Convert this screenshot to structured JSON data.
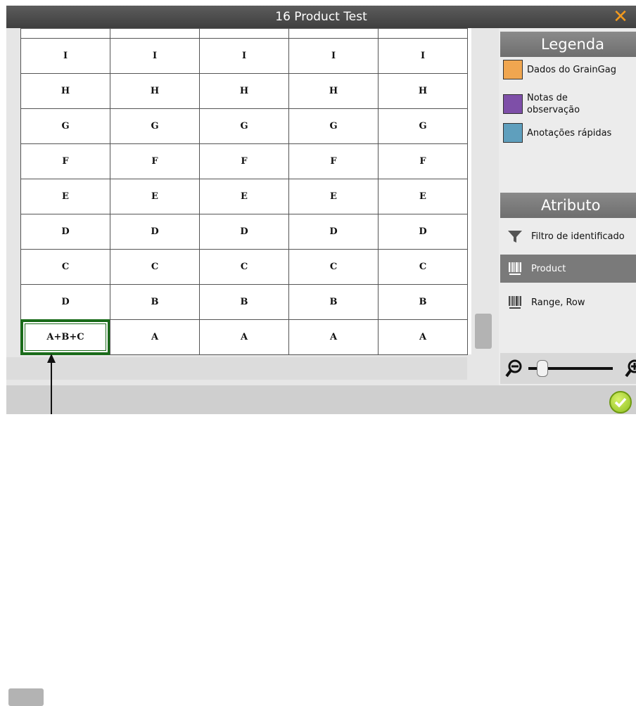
{
  "window": {
    "title": "16 Product Test",
    "close_glyph": "✕"
  },
  "grid": {
    "columns": 5,
    "rows": [
      [
        "",
        "",
        "",
        "",
        ""
      ],
      [
        "I",
        "I",
        "I",
        "I",
        "I"
      ],
      [
        "H",
        "H",
        "H",
        "H",
        "H"
      ],
      [
        "G",
        "G",
        "G",
        "G",
        "G"
      ],
      [
        "F",
        "F",
        "F",
        "F",
        "F"
      ],
      [
        "E",
        "E",
        "E",
        "E",
        "E"
      ],
      [
        "D",
        "D",
        "D",
        "D",
        "D"
      ],
      [
        "C",
        "C",
        "C",
        "C",
        "C"
      ],
      [
        "D",
        "B",
        "B",
        "B",
        "B"
      ],
      [
        "A+B+C",
        "A",
        "A",
        "A",
        "A"
      ]
    ],
    "selected_cell": {
      "row": 9,
      "col": 0
    }
  },
  "legend": {
    "title": "Legenda",
    "items": [
      {
        "label": "Dados do GrainGag",
        "color": "#f0a650"
      },
      {
        "label": "Notas de observação",
        "color": "#7e4fa8"
      },
      {
        "label": "Anotações rápidas",
        "color": "#5f9fbd"
      }
    ]
  },
  "attribute": {
    "title": "Atributo",
    "filter_label": "Filtro de identificado",
    "items": [
      {
        "label": "Product",
        "active": true
      },
      {
        "label": "Range, Row",
        "active": false
      }
    ]
  },
  "zoom": {
    "zoom_out_icon": "zoom-out-icon",
    "zoom_in_icon": "zoom-in-icon",
    "level": 0.1
  },
  "colors": {
    "accent_close": "#f39a1e",
    "selected_border": "#1a6b1a",
    "ok_green": "#8cbf1f"
  }
}
